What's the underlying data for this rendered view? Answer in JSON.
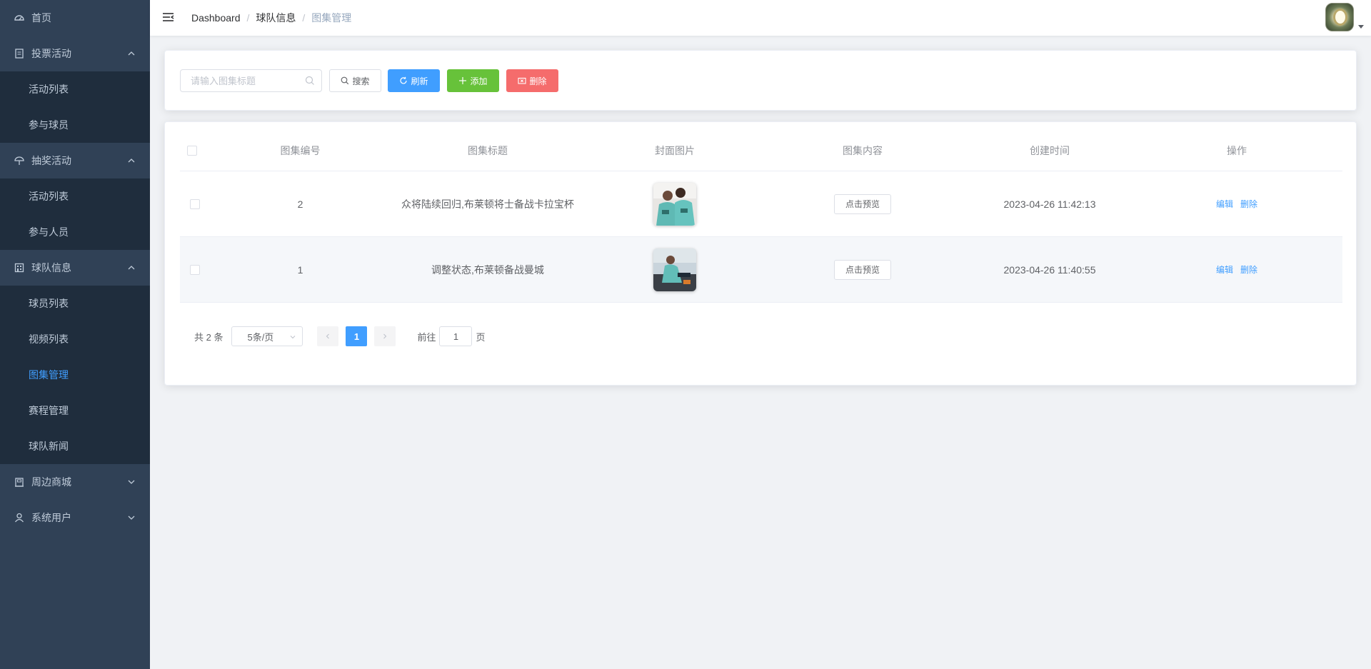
{
  "sidebar": {
    "home": {
      "label": "首页",
      "icon": "dashboard-icon"
    },
    "vote": {
      "label": "投票活动",
      "icon": "document-icon",
      "children": [
        "活动列表",
        "参与球员"
      ]
    },
    "lottery": {
      "label": "抽奖活动",
      "icon": "umbrella-icon",
      "children": [
        "活动列表",
        "参与人员"
      ]
    },
    "team": {
      "label": "球队信息",
      "icon": "office-building-icon",
      "children": [
        "球员列表",
        "视频列表",
        "图集管理",
        "赛程管理",
        "球队新闻"
      ],
      "active": "图集管理"
    },
    "shop": {
      "label": "周边商城",
      "icon": "school-icon"
    },
    "users": {
      "label": "系统用户",
      "icon": "user-icon"
    }
  },
  "navbar": {
    "breadcrumb": [
      "Dashboard",
      "球队信息",
      "图集管理"
    ],
    "separator": "/"
  },
  "toolbar": {
    "search_placeholder": "请输入图集标题",
    "search_label": "搜索",
    "refresh_label": "刷新",
    "add_label": "添加",
    "delete_label": "删除"
  },
  "table": {
    "headers": [
      "图集编号",
      "图集标题",
      "封面图片",
      "图集内容",
      "创建时间",
      "操作"
    ],
    "rows": [
      {
        "id": "2",
        "title": "众将陆续回归,布莱顿将士备战卡拉宝杯",
        "preview": "点击预览",
        "created": "2023-04-26 11:42:13",
        "edit": "编辑",
        "delete": "删除"
      },
      {
        "id": "1",
        "title": "调整状态,布莱顿备战曼城",
        "preview": "点击预览",
        "created": "2023-04-26 11:40:55",
        "edit": "编辑",
        "delete": "删除"
      }
    ]
  },
  "pagination": {
    "total": "共 2 条",
    "page_size": "5条/页",
    "current": "1",
    "goto_prefix": "前往",
    "goto_value": "1",
    "goto_suffix": "页"
  },
  "colors": {
    "sidebar_bg": "#304156",
    "submenu_bg": "#1f2d3d",
    "primary": "#409eff",
    "success": "#67c23a",
    "danger": "#f56c6c"
  }
}
